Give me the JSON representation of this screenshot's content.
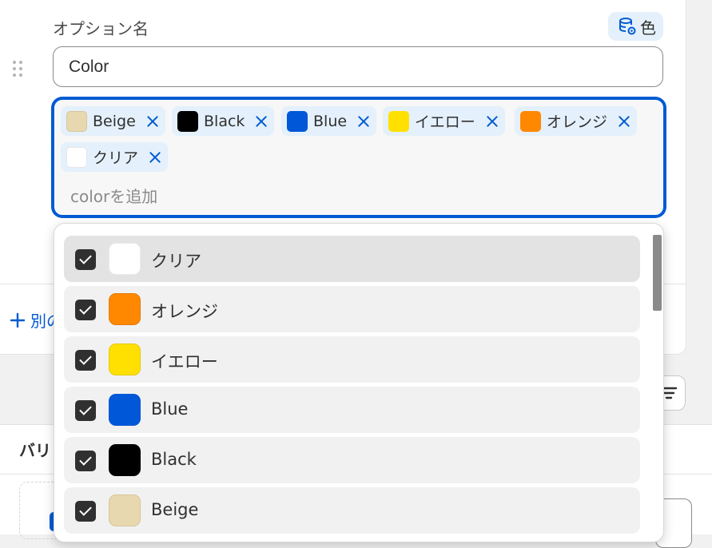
{
  "option": {
    "label": "オプション名",
    "metafield_badge": "色",
    "name_value": "Color"
  },
  "tags": [
    {
      "label": "Beige",
      "color": "#e8d8b0"
    },
    {
      "label": "Black",
      "color": "#000000"
    },
    {
      "label": "Blue",
      "color": "#0057d8"
    },
    {
      "label": "イエロー",
      "color": "#ffe000"
    },
    {
      "label": "オレンジ",
      "color": "#ff8800"
    },
    {
      "label": "クリア",
      "color": "#ffffff"
    }
  ],
  "add_placeholder": "colorを追加",
  "add_another_label": "別の",
  "variants_title": "バリ",
  "dropdown_items": [
    {
      "label": "クリア",
      "color": "#ffffff",
      "checked": true
    },
    {
      "label": "オレンジ",
      "color": "#ff8800",
      "checked": true
    },
    {
      "label": "イエロー",
      "color": "#ffe000",
      "checked": true
    },
    {
      "label": "Blue",
      "color": "#0057d8",
      "checked": true
    },
    {
      "label": "Black",
      "color": "#000000",
      "checked": true
    },
    {
      "label": "Beige",
      "color": "#e8d8b0",
      "checked": true
    }
  ],
  "icons": {
    "metafield": "database-link-icon",
    "drag": "drag-handle-icon",
    "remove": "close-icon",
    "add": "plus-icon",
    "sort": "sort-icon",
    "checkbox": "checkmark-icon"
  }
}
